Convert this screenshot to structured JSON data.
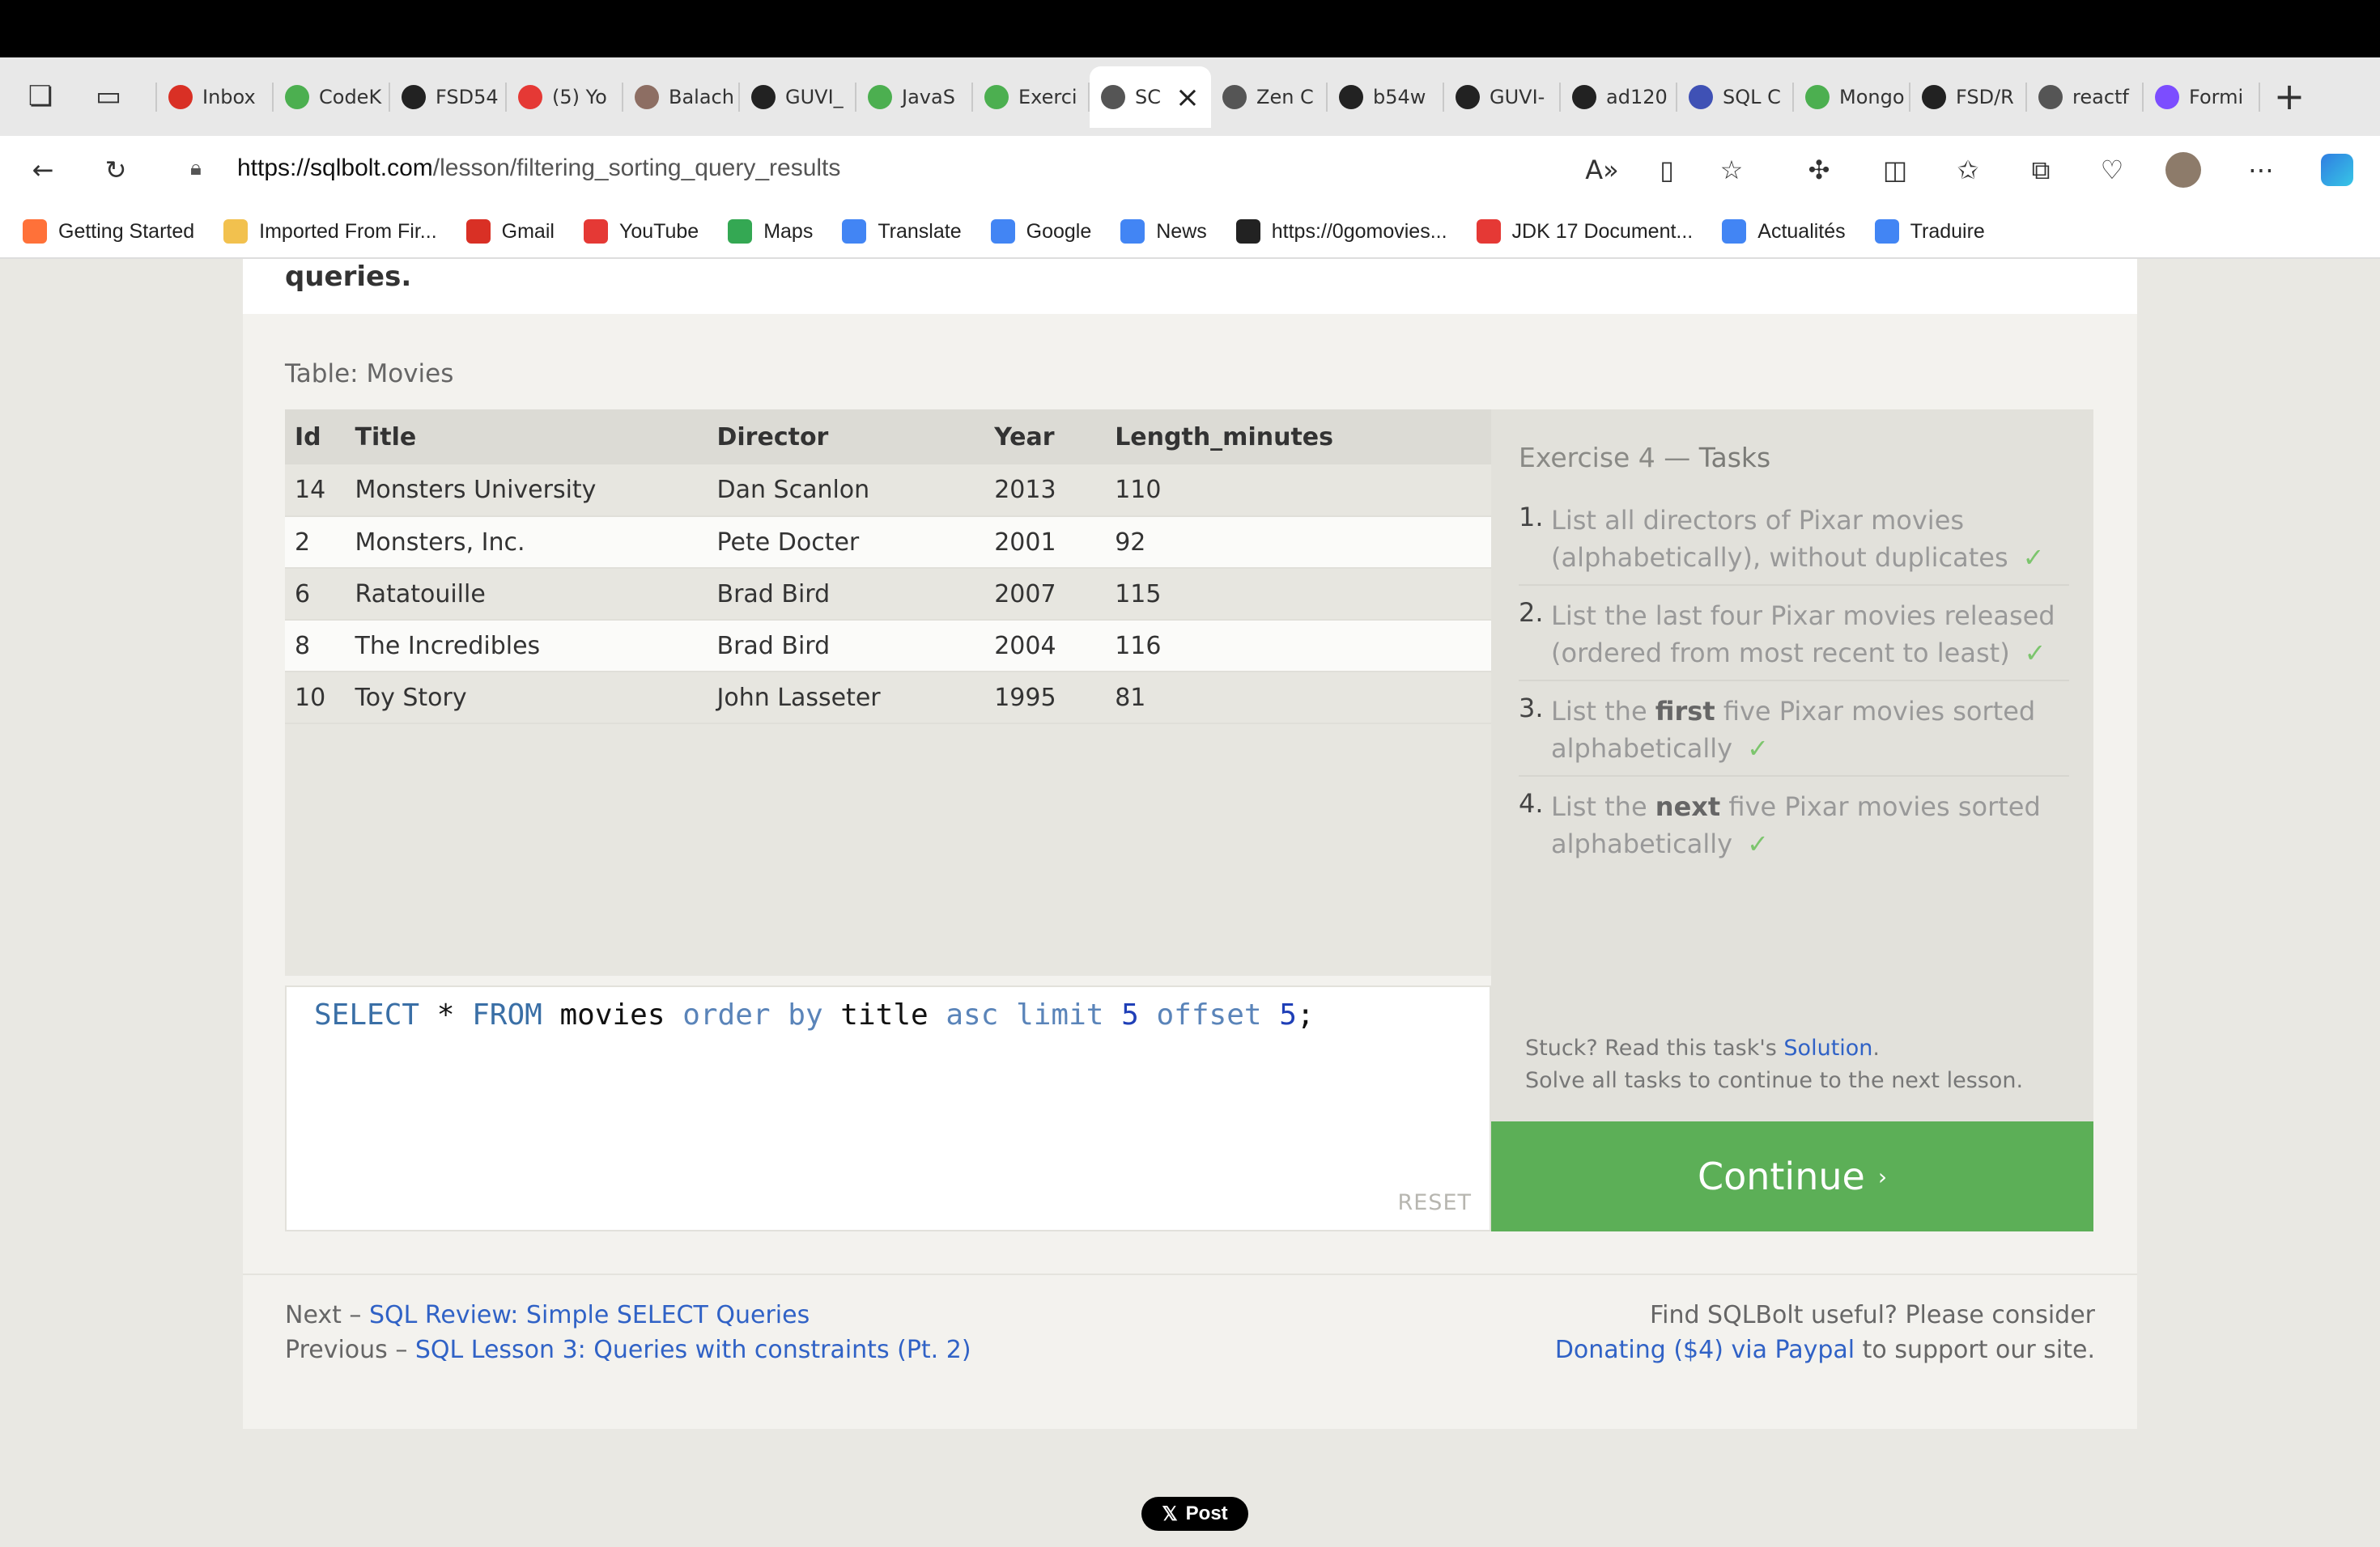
{
  "browser": {
    "tabs": [
      {
        "label": "",
        "favicon": "gmail-icon",
        "color": "#d93025"
      },
      {
        "label": "Inbox",
        "favicon": "gmail-icon",
        "color": "#d93025"
      },
      {
        "label": "CodeK",
        "favicon": "codekata-icon",
        "color": "#4caf50"
      },
      {
        "label": "FSD54",
        "favicon": "github-icon",
        "color": "#222222"
      },
      {
        "label": "(5) Yo",
        "favicon": "youtube-icon",
        "color": "#e53935"
      },
      {
        "label": "Balach",
        "favicon": "avatar-icon",
        "color": "#8d6e63"
      },
      {
        "label": "GUVI_",
        "favicon": "github-icon",
        "color": "#222222"
      },
      {
        "label": "JavaS",
        "favicon": "w3schools-icon",
        "color": "#4caf50"
      },
      {
        "label": "Exerci",
        "favicon": "w3schools-icon",
        "color": "#4caf50"
      },
      {
        "label": "SC",
        "favicon": "database-icon",
        "color": "#555555",
        "active": true
      },
      {
        "label": "Zen C",
        "favicon": "zen-icon",
        "color": "#555555"
      },
      {
        "label": "b54w",
        "favicon": "github-icon",
        "color": "#222222"
      },
      {
        "label": "GUVI-",
        "favicon": "github-icon",
        "color": "#222222"
      },
      {
        "label": "ad120",
        "favicon": "github-icon",
        "color": "#222222"
      },
      {
        "label": "SQL C",
        "favicon": "sql-icon",
        "color": "#3f51b5"
      },
      {
        "label": "Mongo",
        "favicon": "mongodb-icon",
        "color": "#4caf50"
      },
      {
        "label": "FSD/R",
        "favicon": "github-icon",
        "color": "#222222"
      },
      {
        "label": "reactf",
        "favicon": "netlify-icon",
        "color": "#555555"
      },
      {
        "label": "Formi",
        "favicon": "vite-icon",
        "color": "#7c4dff"
      }
    ],
    "url_host": "https://sqlbolt.com",
    "url_path": "/lesson/filtering_sorting_query_results",
    "bookmarks": [
      {
        "label": "Getting Started",
        "icon": "firefox-icon",
        "color": "#ff7139"
      },
      {
        "label": "Imported From Fir...",
        "icon": "folder-icon",
        "color": "#f2c14e"
      },
      {
        "label": "Gmail",
        "icon": "gmail-icon",
        "color": "#d93025"
      },
      {
        "label": "YouTube",
        "icon": "youtube-icon",
        "color": "#e53935"
      },
      {
        "label": "Maps",
        "icon": "maps-icon",
        "color": "#34a853"
      },
      {
        "label": "Translate",
        "icon": "translate-icon",
        "color": "#4285f4"
      },
      {
        "label": "Google",
        "icon": "google-icon",
        "color": "#4285f4"
      },
      {
        "label": "News",
        "icon": "news-icon",
        "color": "#4285f4"
      },
      {
        "label": "https://0gomovies...",
        "icon": "gomovies-icon",
        "color": "#222222"
      },
      {
        "label": "JDK 17 Document...",
        "icon": "oracle-icon",
        "color": "#e53935"
      },
      {
        "label": "Actualités",
        "icon": "news-icon",
        "color": "#4285f4"
      },
      {
        "label": "Traduire",
        "icon": "translate-icon",
        "color": "#4285f4"
      }
    ]
  },
  "lesson": {
    "intro_tail": "queries.",
    "table_caption": "Table: Movies",
    "columns": [
      "Id",
      "Title",
      "Director",
      "Year",
      "Length_minutes"
    ],
    "rows": [
      [
        "14",
        "Monsters University",
        "Dan Scanlon",
        "2013",
        "110"
      ],
      [
        "2",
        "Monsters, Inc.",
        "Pete Docter",
        "2001",
        "92"
      ],
      [
        "6",
        "Ratatouille",
        "Brad Bird",
        "2007",
        "115"
      ],
      [
        "8",
        "The Incredibles",
        "Brad Bird",
        "2004",
        "116"
      ],
      [
        "10",
        "Toy Story",
        "John Lasseter",
        "1995",
        "81"
      ]
    ],
    "query_tokens": [
      {
        "t": "SELECT",
        "c": "kw"
      },
      {
        "t": " ",
        "c": "id"
      },
      {
        "t": "*",
        "c": "id"
      },
      {
        "t": " ",
        "c": "id"
      },
      {
        "t": "FROM",
        "c": "kw"
      },
      {
        "t": " movies ",
        "c": "id"
      },
      {
        "t": "order",
        "c": "kw2"
      },
      {
        "t": " ",
        "c": "id"
      },
      {
        "t": "by",
        "c": "kw2"
      },
      {
        "t": " title ",
        "c": "id"
      },
      {
        "t": "asc",
        "c": "kw2"
      },
      {
        "t": " ",
        "c": "id"
      },
      {
        "t": "limit",
        "c": "kw2"
      },
      {
        "t": " ",
        "c": "id"
      },
      {
        "t": "5",
        "c": "num"
      },
      {
        "t": " ",
        "c": "id"
      },
      {
        "t": "offset",
        "c": "kw2"
      },
      {
        "t": " ",
        "c": "id"
      },
      {
        "t": "5",
        "c": "num"
      },
      {
        "t": ";",
        "c": "id"
      }
    ],
    "reset_label": "RESET",
    "tasks_title_prefix": "Exercise 4 — ",
    "tasks_title_word": "Tasks",
    "tasks": [
      {
        "num": "1.",
        "parts": [
          "List all directors of Pixar movies (alphabetically), without duplicates"
        ],
        "done": true
      },
      {
        "num": "2.",
        "parts": [
          "List the last four Pixar movies released (ordered from most recent to least)"
        ],
        "done": true
      },
      {
        "num": "3.",
        "parts": [
          "List the ",
          "first",
          " five Pixar movies sorted alphabetically"
        ],
        "done": true
      },
      {
        "num": "4.",
        "parts": [
          "List the ",
          "next",
          " five Pixar movies sorted alphabetically"
        ],
        "done": true
      }
    ],
    "check_mark": "✓",
    "stuck_prefix": "Stuck? Read this task's ",
    "stuck_link": "Solution",
    "stuck_suffix": ".",
    "solve_all": "Solve all tasks to continue to the next lesson.",
    "continue_label": "Continue",
    "continue_chevron": "›"
  },
  "footer": {
    "next_prefix": "Next – ",
    "next_link": "SQL Review: Simple SELECT Queries",
    "prev_prefix": "Previous – ",
    "prev_link": "SQL Lesson 3: Queries with constraints (Pt. 2)",
    "useful": "Find SQLBolt useful? Please consider",
    "donate_link": "Donating ($4) via Paypal",
    "donate_suffix": " to support our site."
  },
  "share": {
    "label": "Post",
    "icon": "x-logo-icon"
  },
  "colors": {
    "accent_green": "#5caf57",
    "link_blue": "#3062c6",
    "check_green": "#7cc56d"
  }
}
